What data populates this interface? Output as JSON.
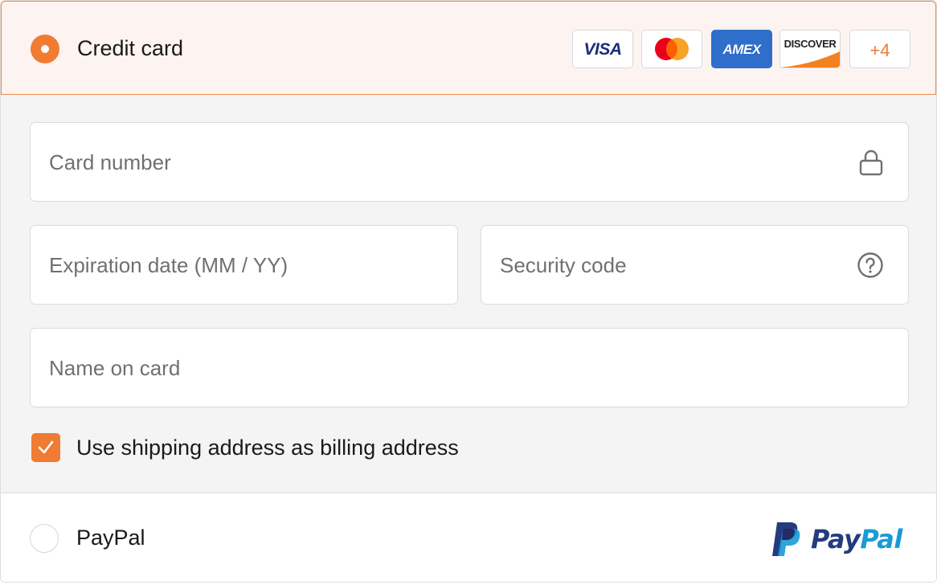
{
  "payment_methods": {
    "credit_card": {
      "label": "Credit card",
      "selected": true,
      "brands": [
        {
          "name": "visa-icon",
          "text": "VISA"
        },
        {
          "name": "mastercard-icon",
          "colors": [
            "#eb001b",
            "#f79e1b"
          ]
        },
        {
          "name": "amex-icon",
          "text": "AMEX"
        },
        {
          "name": "discover-icon",
          "text": "DISCOVER"
        }
      ],
      "more_brands": "+4",
      "fields": {
        "card_number": {
          "placeholder": "Card number",
          "icon": "lock-icon"
        },
        "expiration": {
          "placeholder": "Expiration date (MM / YY)"
        },
        "security_code": {
          "placeholder": "Security code",
          "icon": "help-circle-icon"
        },
        "name_on_card": {
          "placeholder": "Name on card"
        }
      },
      "billing_checkbox": {
        "label": "Use shipping address as billing address",
        "checked": true
      }
    },
    "paypal": {
      "label": "PayPal",
      "selected": false,
      "logo": {
        "pay": "Pay",
        "pal": "Pal"
      }
    }
  },
  "colors": {
    "accent": "#f07c33",
    "selected_bg": "#fdf3f0",
    "body_bg": "#f4f4f4",
    "paypal_dark": "#253b80",
    "paypal_light": "#179bd7"
  }
}
